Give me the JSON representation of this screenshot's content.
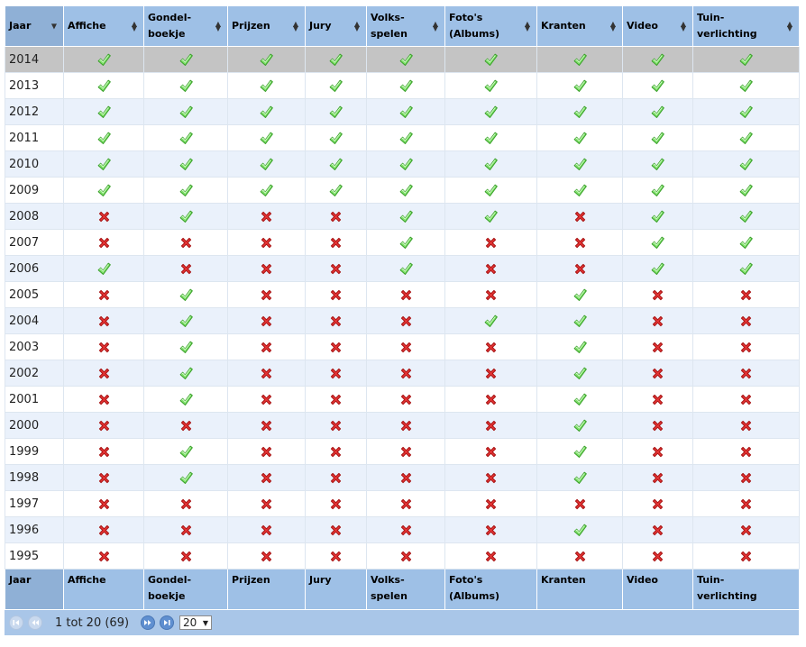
{
  "columns": [
    {
      "line1": "Jaar",
      "line2": ""
    },
    {
      "line1": "Affiche",
      "line2": ""
    },
    {
      "line1": "Gondel-",
      "line2": "boekje"
    },
    {
      "line1": "Prijzen",
      "line2": ""
    },
    {
      "line1": "Jury",
      "line2": ""
    },
    {
      "line1": "Volks-",
      "line2": "spelen"
    },
    {
      "line1": "Foto's",
      "line2": "(Albums)"
    },
    {
      "line1": "Kranten",
      "line2": ""
    },
    {
      "line1": "Video",
      "line2": ""
    },
    {
      "line1": "Tuin-",
      "line2": "verlichting"
    }
  ],
  "rows": [
    {
      "year": "2014",
      "flags": [
        1,
        1,
        1,
        1,
        1,
        1,
        1,
        1,
        1
      ]
    },
    {
      "year": "2013",
      "flags": [
        1,
        1,
        1,
        1,
        1,
        1,
        1,
        1,
        1
      ]
    },
    {
      "year": "2012",
      "flags": [
        1,
        1,
        1,
        1,
        1,
        1,
        1,
        1,
        1
      ]
    },
    {
      "year": "2011",
      "flags": [
        1,
        1,
        1,
        1,
        1,
        1,
        1,
        1,
        1
      ]
    },
    {
      "year": "2010",
      "flags": [
        1,
        1,
        1,
        1,
        1,
        1,
        1,
        1,
        1
      ]
    },
    {
      "year": "2009",
      "flags": [
        1,
        1,
        1,
        1,
        1,
        1,
        1,
        1,
        1
      ]
    },
    {
      "year": "2008",
      "flags": [
        0,
        1,
        0,
        0,
        1,
        1,
        0,
        1,
        1
      ]
    },
    {
      "year": "2007",
      "flags": [
        0,
        0,
        0,
        0,
        1,
        0,
        0,
        1,
        1
      ]
    },
    {
      "year": "2006",
      "flags": [
        1,
        0,
        0,
        0,
        1,
        0,
        0,
        1,
        1
      ]
    },
    {
      "year": "2005",
      "flags": [
        0,
        1,
        0,
        0,
        0,
        0,
        1,
        0,
        0
      ]
    },
    {
      "year": "2004",
      "flags": [
        0,
        1,
        0,
        0,
        0,
        1,
        1,
        0,
        0
      ]
    },
    {
      "year": "2003",
      "flags": [
        0,
        1,
        0,
        0,
        0,
        0,
        1,
        0,
        0
      ]
    },
    {
      "year": "2002",
      "flags": [
        0,
        1,
        0,
        0,
        0,
        0,
        1,
        0,
        0
      ]
    },
    {
      "year": "2001",
      "flags": [
        0,
        1,
        0,
        0,
        0,
        0,
        1,
        0,
        0
      ]
    },
    {
      "year": "2000",
      "flags": [
        0,
        0,
        0,
        0,
        0,
        0,
        1,
        0,
        0
      ]
    },
    {
      "year": "1999",
      "flags": [
        0,
        1,
        0,
        0,
        0,
        0,
        1,
        0,
        0
      ]
    },
    {
      "year": "1998",
      "flags": [
        0,
        1,
        0,
        0,
        0,
        0,
        1,
        0,
        0
      ]
    },
    {
      "year": "1997",
      "flags": [
        0,
        0,
        0,
        0,
        0,
        0,
        0,
        0,
        0
      ]
    },
    {
      "year": "1996",
      "flags": [
        0,
        0,
        0,
        0,
        0,
        0,
        1,
        0,
        0
      ]
    },
    {
      "year": "1995",
      "flags": [
        0,
        0,
        0,
        0,
        0,
        0,
        0,
        0,
        0
      ]
    }
  ],
  "pager": {
    "info": "1 tot 20 (69)",
    "page_size": "20",
    "first_icon": "first-page-icon",
    "prev_icon": "previous-page-icon",
    "next_icon": "next-page-icon",
    "last_icon": "last-page-icon"
  },
  "icons": {
    "yes": "check-icon",
    "no": "cross-icon"
  },
  "colors": {
    "header": "#9ec0e6",
    "row_alt": "#eaf1fb",
    "row_selected": "#c4c4c4",
    "check": "#5bd14a",
    "cross": "#e53030"
  }
}
